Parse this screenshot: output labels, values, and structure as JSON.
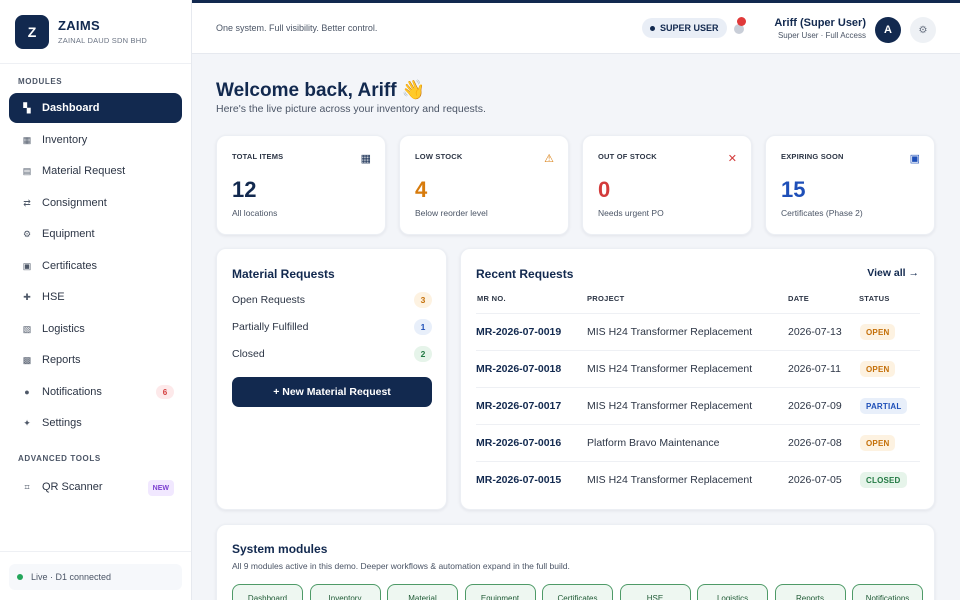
{
  "brand": {
    "name": "ZAIMS",
    "subtitle": "ZAINAL DAUD SDN BHD",
    "logo_letter": "Z"
  },
  "sidebar": {
    "modules_label": "MODULES",
    "advanced_label": "ADVANCED TOOLS",
    "items": [
      {
        "label": "Dashboard",
        "icon": "dashboard-icon",
        "glyph": "▚"
      },
      {
        "label": "Inventory",
        "icon": "inventory-icon",
        "glyph": "▦"
      },
      {
        "label": "Material Request",
        "icon": "material-request-icon",
        "glyph": "▤"
      },
      {
        "label": "Consignment",
        "icon": "consignment-icon",
        "glyph": "⇄"
      },
      {
        "label": "Equipment",
        "icon": "equipment-icon",
        "glyph": "⚙"
      },
      {
        "label": "Certificates",
        "icon": "certificates-icon",
        "glyph": "▣"
      },
      {
        "label": "HSE",
        "icon": "hse-icon",
        "glyph": "✚"
      },
      {
        "label": "Logistics",
        "icon": "logistics-icon",
        "glyph": "▧"
      },
      {
        "label": "Reports",
        "icon": "reports-icon",
        "glyph": "▩"
      },
      {
        "label": "Notifications",
        "icon": "bell-icon",
        "glyph": "●",
        "badge": "6"
      },
      {
        "label": "Settings",
        "icon": "settings-icon",
        "glyph": "✦"
      }
    ],
    "advanced_items": [
      {
        "label": "QR Scanner",
        "icon": "qr-icon",
        "glyph": "⌗",
        "badge": "NEW"
      }
    ],
    "footer": "Live · D1 connected"
  },
  "topbar": {
    "tagline": "One system. Full visibility. Better control.",
    "role": "SUPER USER",
    "notification_count": "1",
    "user_name": "Ariff (Super User)",
    "user_role": "Super User · Full Access",
    "avatar_letter": "A",
    "settings_glyph": "⚙"
  },
  "welcome": {
    "title": "Welcome back, Ariff 👋",
    "subtitle": "Here's the live picture across your inventory and requests."
  },
  "stats": [
    {
      "label": "TOTAL ITEMS",
      "value": "12",
      "sub": "All locations",
      "icon": "grid-icon",
      "glyph": "▦",
      "color": "#12294f",
      "icon_color": "#12294f"
    },
    {
      "label": "LOW STOCK",
      "value": "4",
      "sub": "Below reorder level",
      "icon": "warning-icon",
      "glyph": "⚠",
      "color": "#d77b0c",
      "icon_color": "#d77b0c"
    },
    {
      "label": "OUT OF STOCK",
      "value": "0",
      "sub": "Needs urgent PO",
      "icon": "close-icon",
      "glyph": "✕",
      "color": "#d33b3b",
      "icon_color": "#d33b3b"
    },
    {
      "label": "EXPIRING SOON",
      "value": "15",
      "sub": "Certificates (Phase 2)",
      "icon": "certificate-icon",
      "glyph": "▣",
      "color": "#1e4fb8",
      "icon_color": "#1e4fb8"
    }
  ],
  "material_requests": {
    "title": "Material Requests",
    "rows": [
      {
        "label": "Open Requests",
        "count": "3",
        "bg": "#fdf2e1",
        "fg": "#c46f08"
      },
      {
        "label": "Partially Fulfilled",
        "count": "1",
        "bg": "#e8effa",
        "fg": "#1e4fb8"
      },
      {
        "label": "Closed",
        "count": "2",
        "bg": "#e6f4ea",
        "fg": "#237a44"
      }
    ],
    "button": "+ New Material Request"
  },
  "recent_requests": {
    "title": "Recent Requests",
    "view_all": "View all →",
    "columns": [
      "MR NO.",
      "PROJECT",
      "DATE",
      "STATUS"
    ],
    "rows": [
      {
        "mr": "MR-2026-07-0019",
        "project": "MIS H24 Transformer Replacement",
        "date": "2026-07-13",
        "status": "OPEN"
      },
      {
        "mr": "MR-2026-07-0018",
        "project": "MIS H24 Transformer Replacement",
        "date": "2026-07-11",
        "status": "OPEN"
      },
      {
        "mr": "MR-2026-07-0017",
        "project": "MIS H24 Transformer Replacement",
        "date": "2026-07-09",
        "status": "PARTIAL"
      },
      {
        "mr": "MR-2026-07-0016",
        "project": "Platform Bravo Maintenance",
        "date": "2026-07-08",
        "status": "OPEN"
      },
      {
        "mr": "MR-2026-07-0015",
        "project": "MIS H24 Transformer Replacement",
        "date": "2026-07-05",
        "status": "CLOSED"
      }
    ],
    "status_colors": {
      "OPEN": {
        "bg": "#fdf2e1",
        "fg": "#c46f08"
      },
      "PARTIAL": {
        "bg": "#e8effa",
        "fg": "#1e4fb8"
      },
      "CLOSED": {
        "bg": "#e6f4ea",
        "fg": "#237a44"
      }
    }
  },
  "system_modules": {
    "title": "System modules",
    "subtitle": "All 9 modules active in this demo. Deeper workflows & automation expand in the full build.",
    "chips": [
      "Dashboard",
      "Inventory",
      "Material",
      "Equipment",
      "Certificates",
      "HSE",
      "Logistics",
      "Reports",
      "Notifications"
    ]
  }
}
